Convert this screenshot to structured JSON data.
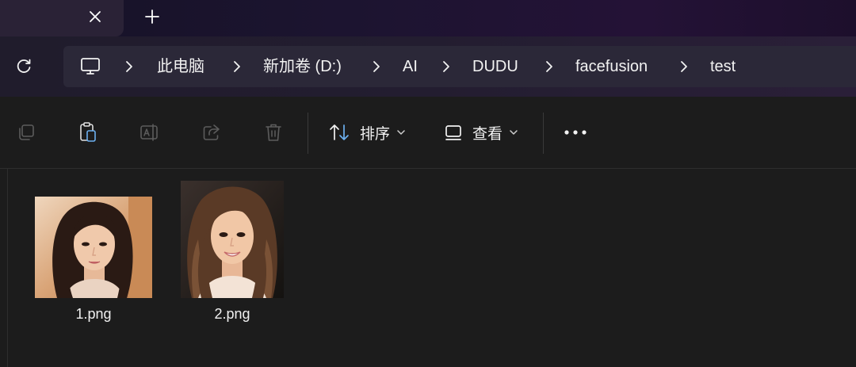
{
  "tab": {
    "close_glyph": "✕",
    "new_tab_glyph": "+"
  },
  "nav": {
    "refresh_icon": "refresh-icon",
    "breadcrumb": [
      "此电脑",
      "新加卷 (D:)",
      "AI",
      "DUDU",
      "facefusion",
      "test"
    ]
  },
  "toolbar": {
    "sort_label": "排序",
    "view_label": "查看",
    "more_label": "•••",
    "icons": [
      "copy-icon",
      "paste-icon",
      "rename-icon",
      "share-icon",
      "delete-icon"
    ]
  },
  "files": [
    {
      "name": "1.png",
      "thumb_colors": {
        "bg": "#c48a5c",
        "bg2": "#e8c9a8",
        "hair": "#2a1a14",
        "skin": "#efc7a8",
        "shirt": "#e9d2c0"
      }
    },
    {
      "name": "2.png",
      "thumb_colors": {
        "bg": "#1d1a18",
        "bg2": "#3a2e28",
        "hair": "#5a3a26",
        "skin": "#f1c7a6",
        "shirt": "#f3e3d6"
      }
    }
  ],
  "colors": {
    "accent_title": "#241236",
    "address_bg": "#2b2838",
    "content_bg": "#1c1c1c"
  }
}
